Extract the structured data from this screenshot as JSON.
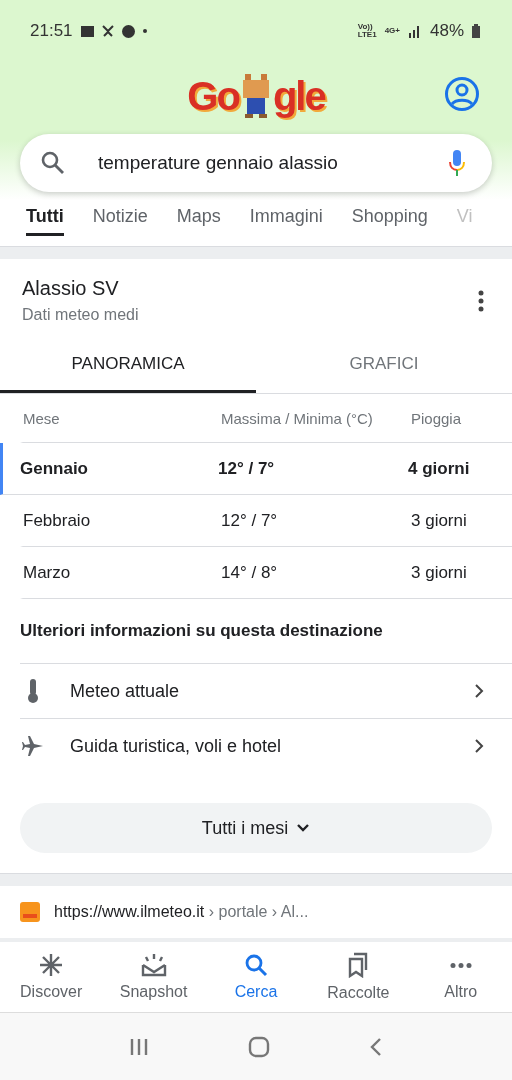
{
  "status_bar": {
    "time": "21:51",
    "network": [
      "Vo))",
      "LTE1",
      "4G+"
    ],
    "battery": "48%"
  },
  "logo": {
    "left": "Go",
    "right": "gle"
  },
  "search": {
    "value": "temperature gennaio alassio"
  },
  "tabs": [
    {
      "label": "Tutti",
      "selected": true
    },
    {
      "label": "Notizie",
      "selected": false
    },
    {
      "label": "Maps",
      "selected": false
    },
    {
      "label": "Immagini",
      "selected": false
    },
    {
      "label": "Shopping",
      "selected": false
    },
    {
      "label": "Vi",
      "selected": false
    }
  ],
  "weather": {
    "title": "Alassio SV",
    "subtitle": "Dati meteo medi",
    "tabs": [
      {
        "label": "PANORAMICA",
        "selected": true
      },
      {
        "label": "GRAFICI",
        "selected": false
      }
    ],
    "columns": [
      "Mese",
      "Massima / Minima (°C)",
      "Pioggia"
    ],
    "rows": [
      {
        "month": "Gennaio",
        "temps": "12° / 7°",
        "rain": "4 giorni",
        "selected": true
      },
      {
        "month": "Febbraio",
        "temps": "12° / 7°",
        "rain": "3 giorni",
        "selected": false
      },
      {
        "month": "Marzo",
        "temps": "14° / 8°",
        "rain": "3 giorni",
        "selected": false
      }
    ],
    "more_heading": "Ulteriori informazioni su questa destinazione",
    "links": [
      {
        "kind": "thermometer",
        "label": "Meteo attuale"
      },
      {
        "kind": "plane",
        "label": "Guida turistica, voli e hotel"
      }
    ],
    "all_months_button": "Tutti i mesi"
  },
  "result": {
    "url": "https://www.ilmeteo.it",
    "path": " › portale › Al..."
  },
  "bottom_nav": [
    {
      "kind": "discover",
      "label": "Discover",
      "selected": false
    },
    {
      "kind": "snapshot",
      "label": "Snapshot",
      "selected": false
    },
    {
      "kind": "search",
      "label": "Cerca",
      "selected": true
    },
    {
      "kind": "collections",
      "label": "Raccolte",
      "selected": false
    },
    {
      "kind": "more",
      "label": "Altro",
      "selected": false
    }
  ]
}
